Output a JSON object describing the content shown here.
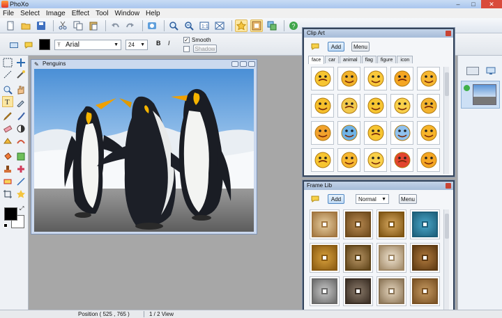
{
  "app": {
    "title": "PhoXo"
  },
  "menu": [
    "File",
    "Select",
    "Image",
    "Effect",
    "Tool",
    "Window",
    "Help"
  ],
  "propbar": {
    "font_name": "Arial",
    "font_size": "24",
    "bold_label": "B",
    "italic_label": "I",
    "smooth_label": "Smooth",
    "smooth_checked": true,
    "shadow_label": "Shadow",
    "shadow_checked": false
  },
  "image_window": {
    "title": "Penguins"
  },
  "clipart": {
    "title": "Clip Art",
    "add_label": "Add",
    "menu_label": "Menu",
    "tabs": [
      "face",
      "car",
      "animal",
      "flag",
      "figure",
      "icon"
    ],
    "active_tab": "face"
  },
  "framelib": {
    "title": "Frame Lib",
    "add_label": "Add",
    "mode": "Normal",
    "menu_label": "Menu"
  },
  "status": {
    "position": "Position ( 525 , 765 )",
    "view": "1 / 2 View"
  },
  "colors": {
    "foreground": "#000000",
    "background": "#ffffff",
    "accent": "#4f87c3"
  }
}
